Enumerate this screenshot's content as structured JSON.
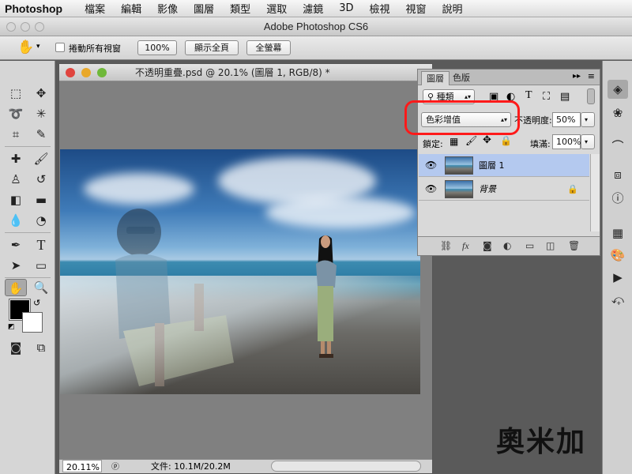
{
  "menubar": {
    "app": "Photoshop",
    "items": [
      "檔案",
      "編輯",
      "影像",
      "圖層",
      "類型",
      "選取",
      "濾鏡",
      "3D",
      "檢視",
      "視窗",
      "說明"
    ]
  },
  "window": {
    "title": "Adobe Photoshop CS6"
  },
  "options": {
    "scroll_all_label": "捲動所有視窗",
    "zoom_100_label": "100%",
    "fit_screen_label": "顯示全頁",
    "fill_screen_label": "全螢幕"
  },
  "document": {
    "title": "不透明重疊.psd @ 20.1% (圖層 1, RGB/8) *",
    "zoom": "20.11%",
    "file_info": "文件: 10.1M/20.2M"
  },
  "layers_panel": {
    "tabs": [
      "圖層",
      "色版"
    ],
    "filter_label": "種類",
    "blend_mode": "色彩增值",
    "opacity_label": "不透明度:",
    "opacity_value": "50%",
    "lock_label": "鎖定:",
    "fill_label": "填滿:",
    "fill_value": "100%",
    "layers": [
      {
        "name": "圖層 1",
        "selected": true
      },
      {
        "name": "背景",
        "selected": false,
        "locked": true
      }
    ],
    "footer_icons": [
      "link-icon",
      "fx-icon",
      "mask-icon",
      "adjustment-icon",
      "folder-icon",
      "new-layer-icon",
      "trash-icon"
    ]
  },
  "watermark": "奧米加",
  "colors": {
    "highlight": "#ff1a1a",
    "selected_layer": "#b4c9ef"
  }
}
